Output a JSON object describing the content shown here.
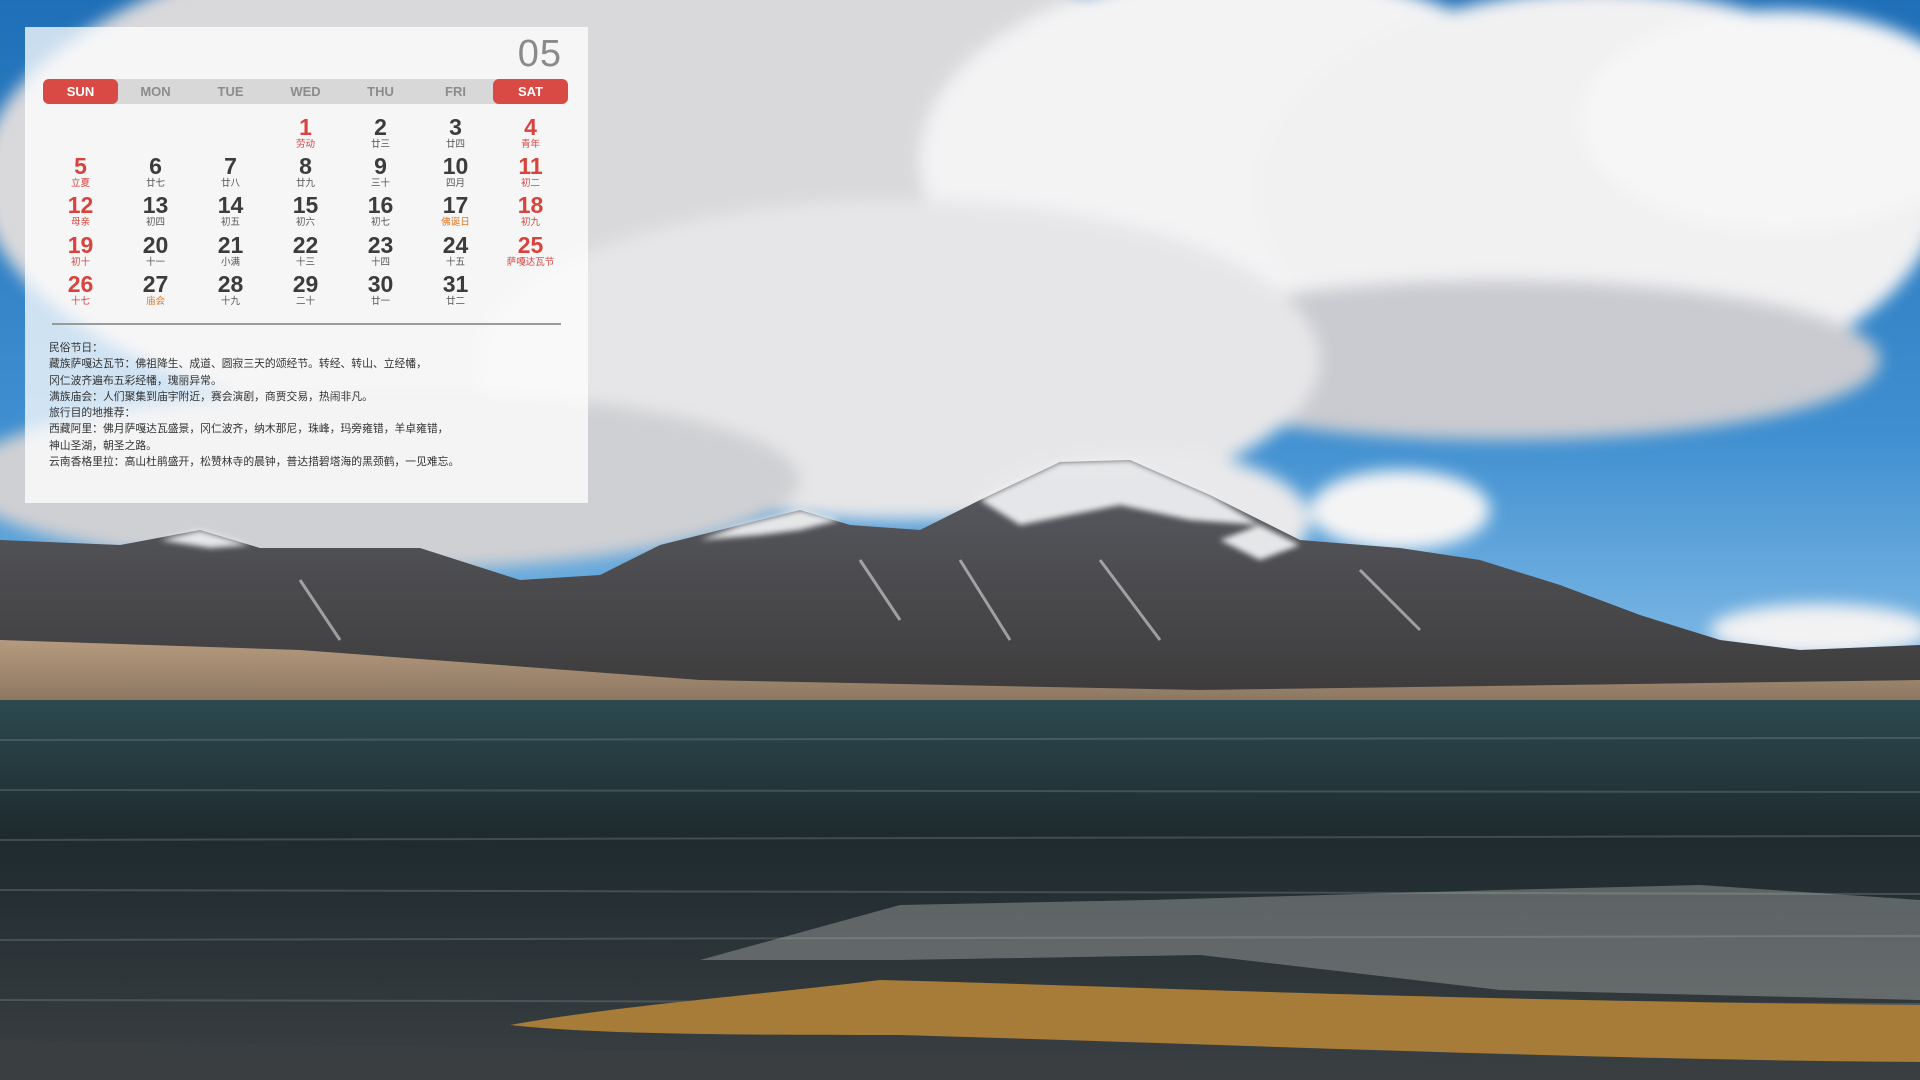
{
  "calendar": {
    "month": "05",
    "weekdays": [
      "SUN",
      "MON",
      "TUE",
      "WED",
      "THU",
      "FRI",
      "SAT"
    ],
    "days": [
      null,
      null,
      null,
      {
        "n": "1",
        "l": "劳动",
        "red": true
      },
      {
        "n": "2",
        "l": "廿三"
      },
      {
        "n": "3",
        "l": "廿四"
      },
      {
        "n": "4",
        "l": "青年",
        "red": true
      },
      {
        "n": "5",
        "l": "立夏",
        "red": true
      },
      {
        "n": "6",
        "l": "廿七"
      },
      {
        "n": "7",
        "l": "廿八"
      },
      {
        "n": "8",
        "l": "廿九"
      },
      {
        "n": "9",
        "l": "三十"
      },
      {
        "n": "10",
        "l": "四月"
      },
      {
        "n": "11",
        "l": "初二",
        "red": true
      },
      {
        "n": "12",
        "l": "母亲",
        "red": true
      },
      {
        "n": "13",
        "l": "初四"
      },
      {
        "n": "14",
        "l": "初五"
      },
      {
        "n": "15",
        "l": "初六"
      },
      {
        "n": "16",
        "l": "初七"
      },
      {
        "n": "17",
        "l": "佛诞日",
        "orange": true
      },
      {
        "n": "18",
        "l": "初九",
        "red": true
      },
      {
        "n": "19",
        "l": "初十",
        "red": true
      },
      {
        "n": "20",
        "l": "十一"
      },
      {
        "n": "21",
        "l": "小满"
      },
      {
        "n": "22",
        "l": "十三"
      },
      {
        "n": "23",
        "l": "十四"
      },
      {
        "n": "24",
        "l": "十五"
      },
      {
        "n": "25",
        "l": "萨嘎达瓦节",
        "red": true
      },
      {
        "n": "26",
        "l": "十七",
        "red": true
      },
      {
        "n": "27",
        "l": "庙会",
        "orange": true
      },
      {
        "n": "28",
        "l": "十九"
      },
      {
        "n": "29",
        "l": "二十"
      },
      {
        "n": "30",
        "l": "廿一"
      },
      {
        "n": "31",
        "l": "廿二"
      }
    ],
    "notes": [
      "民俗节日：",
      "藏族萨嘎达瓦节：佛祖降生、成道、圆寂三天的颂经节。转经、转山、立经幡，",
      "冈仁波齐遍布五彩经幡，瑰丽异常。",
      "满族庙会：人们聚集到庙宇附近，赛会演剧，商贾交易，热闹非凡。",
      "旅行目的地推荐：",
      "西藏阿里：佛月萨嘎达瓦盛景，冈仁波齐，纳木那尼，珠峰，玛旁雍错，羊卓雍错，",
      "神山圣湖，朝圣之路。",
      "云南香格里拉：高山杜鹃盛开，松赞林寺的晨钟，普达措碧塔海的黑颈鹤，一见难忘。"
    ]
  },
  "colors": {
    "accent_red": "#d94a45",
    "accent_orange": "#e0751f",
    "text_dark": "#3c3c3c"
  }
}
